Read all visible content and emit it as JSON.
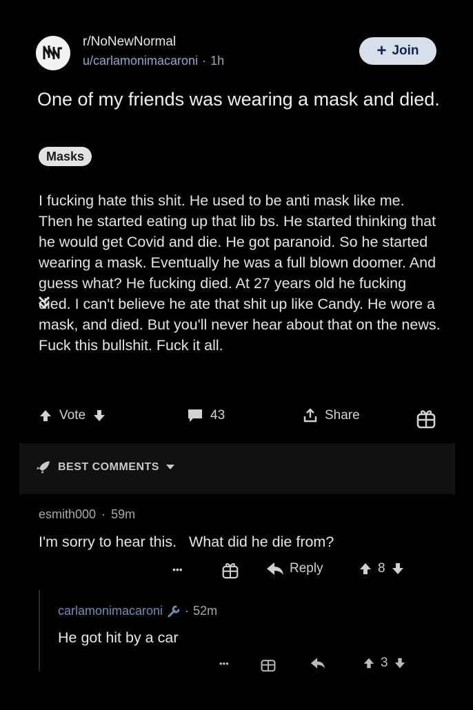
{
  "post": {
    "subreddit": "r/NoNewNormal",
    "author": "u/carlamonimacaroni",
    "separator": "·",
    "age": "1h",
    "join_label": "Join",
    "title": "One of my friends was wearing a mask and died.",
    "flair": "Masks",
    "body": "I fucking hate this shit. He used to be anti mask like me. Then he started eating up that lib bs. He started thinking that he would get Covid and die. He got paranoid. So he started wearing a mask. Eventually he was a full blown doomer. And guess what? He fucking died. At 27 years old he fucking died. I can't believe he ate that shit up like Candy. He wore a mask, and died. But you'll never hear about that on the news. Fuck this bullshit. Fuck it all.",
    "vote_label": "Vote",
    "comment_count": "43",
    "share_label": "Share"
  },
  "sort": {
    "label": "BEST COMMENTS"
  },
  "comments": [
    {
      "author": "esmith000",
      "separator": "·",
      "age": "59m",
      "text": "I'm sorry to hear this.   What did he die from?",
      "more": "•••",
      "reply_label": "Reply",
      "score": "8"
    },
    {
      "author": "carlamonimacaroni",
      "separator": "·",
      "age": "52m",
      "text": "He got hit by a car",
      "more": "•••",
      "score": "3"
    }
  ],
  "icons": {
    "subreddit_avatar": "nnn-logo-icon",
    "upvote": "upvote-arrow-icon",
    "downvote": "downvote-arrow-icon",
    "comment": "comment-bubble-icon",
    "share": "share-icon",
    "award": "gift-icon",
    "reply": "reply-arrow-icon",
    "collapse": "double-chevron-down-icon",
    "sort": "rocket-icon",
    "mod": "wrench-icon"
  },
  "colors": {
    "join_bg": "#d7dfea",
    "author_link": "#8fa8c7",
    "op_author": "#6e8db5"
  }
}
